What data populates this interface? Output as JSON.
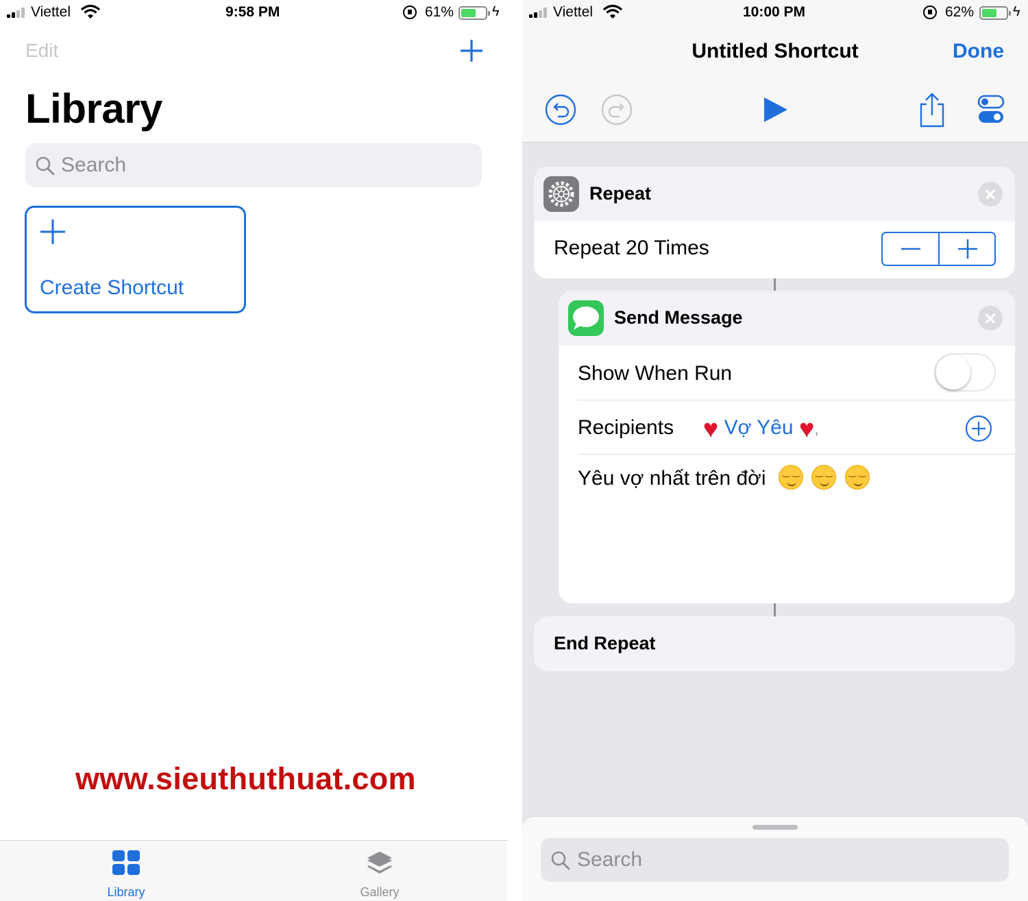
{
  "left_screen": {
    "status": {
      "carrier": "Viettel",
      "time": "9:58 PM",
      "battery": "61%",
      "battery_level": 0.61
    },
    "nav": {
      "edit_label": "Edit"
    },
    "title": "Library",
    "search": {
      "placeholder": "Search"
    },
    "create_card": {
      "label": "Create Shortcut"
    },
    "watermark": "www.sieuthuthuat.com",
    "tabs": [
      {
        "label": "Library",
        "active": true
      },
      {
        "label": "Gallery",
        "active": false
      }
    ]
  },
  "right_screen": {
    "status": {
      "carrier": "Viettel",
      "time": "10:00 PM",
      "battery": "62%",
      "battery_level": 0.62
    },
    "nav": {
      "title": "Untitled Shortcut",
      "done_label": "Done"
    },
    "repeat_action": {
      "title": "Repeat",
      "summary": "Repeat 20 Times"
    },
    "send_message_action": {
      "title": "Send Message",
      "show_when_run_label": "Show When Run",
      "show_when_run": false,
      "recipients_label": "Recipients",
      "recipient": "Vợ Yêu",
      "recipient_separator": ",",
      "message": "Yêu vợ nhất trên đời"
    },
    "end_repeat": {
      "title": "End Repeat"
    },
    "bottom_search": {
      "placeholder": "Search"
    }
  },
  "colors": {
    "accent": "#1e6fdc",
    "watermark": "#c30d0d",
    "battery": "#4cd964",
    "messages_green": "#34c759",
    "settings_gray": "#7b7b80"
  },
  "icons": [
    "signal-icon",
    "wifi-icon",
    "rotation-lock-icon",
    "battery-icon",
    "charging-bolt-icon",
    "plus-icon",
    "search-icon",
    "undo-icon",
    "redo-icon",
    "play-icon",
    "share-icon",
    "settings-toggle-icon",
    "gear-icon",
    "close-icon",
    "minus-icon",
    "messages-icon",
    "heart-icon",
    "add-circle-icon",
    "smile-emoji-icon",
    "library-grid-icon",
    "gallery-layers-icon"
  ]
}
